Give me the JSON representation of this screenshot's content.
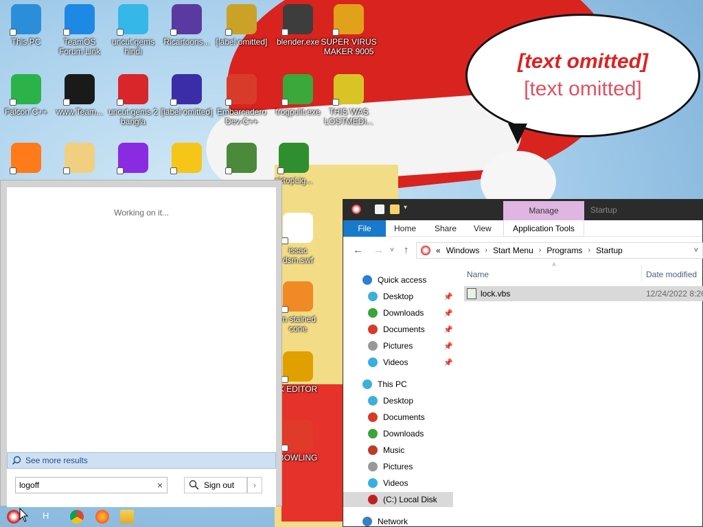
{
  "wallpaper": {
    "bubble_line1": "[text omitted]",
    "bubble_line3": "[text omitted]"
  },
  "desktop_icons": [
    {
      "label": "This PC",
      "icon": "computer-icon",
      "color": "#2a8fd8"
    },
    {
      "label": "TeamOS\nForum Link",
      "icon": "gear-icon",
      "color": "#1e88e5"
    },
    {
      "label": "uncut gems\nhindi",
      "icon": "diamond-icon",
      "color": "#35b7e8"
    },
    {
      "label": "Ricartoons...",
      "icon": "cartoon-icon",
      "color": "#5a3aa0"
    },
    {
      "label": "[label omitted]",
      "icon": "cd-icon",
      "color": "#c9a227"
    },
    {
      "label": "blender.exe",
      "icon": "blender-icon",
      "color": "#3d3d3d"
    },
    {
      "label": "SUPER VIRUS\nMAKER 9005",
      "icon": "case-icon",
      "color": "#e2a11a"
    },
    {
      "label": "Falcon C++",
      "icon": "recycle-icon",
      "color": "#2bb34a"
    },
    {
      "label": "www.Team...",
      "icon": "book-icon",
      "color": "#1a1a1a"
    },
    {
      "label": "uncut gems 2\nbangla",
      "icon": "number-two-icon",
      "color": "#d8262a"
    },
    {
      "label": "[label omitted]",
      "icon": "planet-icon",
      "color": "#3b2da8"
    },
    {
      "label": "Embarcadero\nDev-C++",
      "icon": "devcpp-icon",
      "color": "#d83b2a"
    },
    {
      "label": "frogpulit.exe",
      "icon": "frog-icon",
      "color": "#3aa83a"
    },
    {
      "label": "THIS WAS\nLOSTMEDI...",
      "icon": "blocks-icon",
      "color": "#d9c426"
    },
    {
      "label": "",
      "icon": "firefox-icon",
      "color": "#ff7a18"
    },
    {
      "label": "",
      "icon": "dog-icon",
      "color": "#f0d080"
    },
    {
      "label": "",
      "icon": "gem-ring-icon",
      "color": "#8a2be2"
    },
    {
      "label": "",
      "icon": "yellow-app-icon",
      "color": "#f5c518"
    },
    {
      "label": "",
      "icon": "tree-shield-icon",
      "color": "#4a8a3a"
    },
    {
      "label": "sktopLig...",
      "icon": "xmas-tree-icon",
      "color": "#2f8f2f"
    },
    {
      "label": "issac\ndsm.swf",
      "icon": "flash-file-icon",
      "color": "#ffffff"
    },
    {
      "label": "m stained\ncone",
      "icon": "cone-icon",
      "color": "#f08a24"
    },
    {
      "label": "X EDITOR",
      "icon": "hex-editor-icon",
      "color": "#e0a000"
    },
    {
      "label": "BOWLING",
      "icon": "bowling-icon",
      "color": "#e03a2a"
    }
  ],
  "search": {
    "status": "Working on it...",
    "see_more": "See more results",
    "query": "logoff",
    "action_label": "Sign out"
  },
  "explorer": {
    "manage_tab": "Manage",
    "startup_tab": "Startup",
    "ribbon": {
      "file": "File",
      "home": "Home",
      "share": "Share",
      "view": "View",
      "app_tools": "Application Tools"
    },
    "breadcrumb": {
      "prefix": "«",
      "parts": [
        "Windows",
        "Start Menu",
        "Programs",
        "Startup"
      ]
    },
    "columns": {
      "name": "Name",
      "date": "Date modified"
    },
    "files": [
      {
        "name": "lock.vbs",
        "date": "12/24/2022 8:26"
      }
    ],
    "nav": {
      "quick_access": "Quick access",
      "quick_items": [
        "Desktop",
        "Downloads",
        "Documents",
        "Pictures",
        "Videos"
      ],
      "this_pc": "This PC",
      "pc_items": [
        "Desktop",
        "Documents",
        "Downloads",
        "Music",
        "Pictures",
        "Videos",
        "(C:) Local Disk"
      ],
      "network": "Network"
    }
  },
  "taskbar": {
    "search_hint": "H"
  }
}
